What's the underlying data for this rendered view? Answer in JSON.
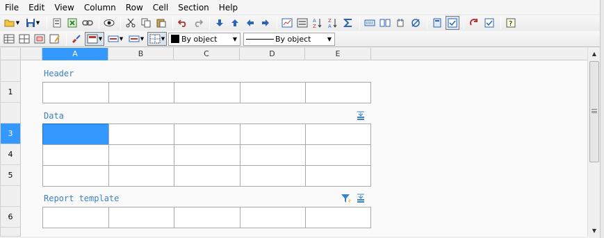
{
  "menu": [
    "File",
    "Edit",
    "View",
    "Column",
    "Row",
    "Cell",
    "Section",
    "Help"
  ],
  "toolbar2": {
    "fill_combo": "By object",
    "line_combo": "By object",
    "fill_swatch_color": "#000000"
  },
  "grid": {
    "columns": [
      "A",
      "B",
      "C",
      "D",
      "E"
    ],
    "active_column": "A",
    "row_numbers": [
      "1",
      "3",
      "4",
      "5",
      "6"
    ],
    "active_row": "3",
    "sections": {
      "header": "Header",
      "data": "Data",
      "report_template": "Report template"
    }
  },
  "colors": {
    "accent": "#3399ff",
    "section_label": "#3b82c4"
  }
}
